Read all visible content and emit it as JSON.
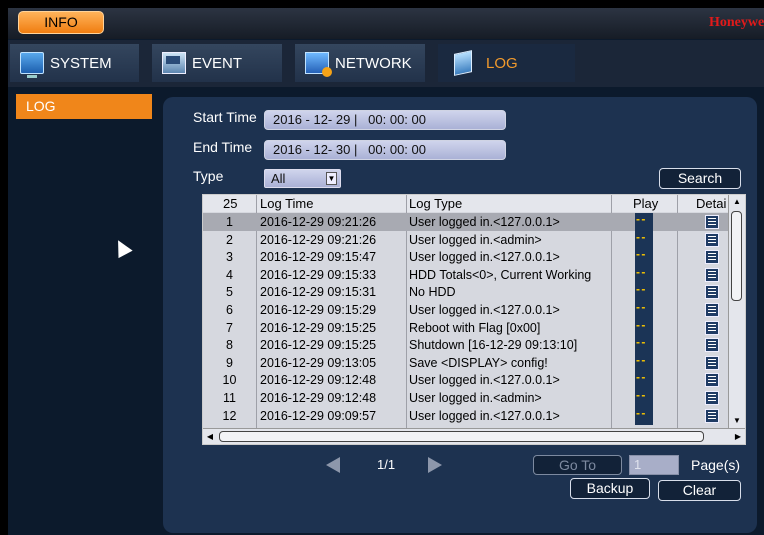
{
  "titlebar": {
    "info_label": "INFO",
    "brand": "Honeywell"
  },
  "tabs": [
    {
      "label": "SYSTEM",
      "icon": "system-icon"
    },
    {
      "label": "EVENT",
      "icon": "event-icon"
    },
    {
      "label": "NETWORK",
      "icon": "network-icon"
    },
    {
      "label": "LOG",
      "icon": "log-icon",
      "active": true
    }
  ],
  "sidebar": {
    "items": [
      {
        "label": "LOG",
        "active": true
      }
    ]
  },
  "filters": {
    "start_label": "Start Time",
    "start_value": "2016 - 12- 29 |   00: 00: 00",
    "end_label": "End Time",
    "end_value": "2016 - 12- 30 |   00: 00: 00",
    "type_label": "Type",
    "type_value": "All",
    "search_label": "Search"
  },
  "table": {
    "headers": {
      "count": "25",
      "time": "Log Time",
      "type": "Log Type",
      "play": "Play",
      "detail": "Detai"
    },
    "rows": [
      {
        "no": "1",
        "time": "2016-12-29 09:21:26",
        "type": "User logged in.<127.0.0.1>"
      },
      {
        "no": "2",
        "time": "2016-12-29 09:21:26",
        "type": "User logged in.<admin>"
      },
      {
        "no": "3",
        "time": "2016-12-29 09:15:47",
        "type": "User logged in.<127.0.0.1>"
      },
      {
        "no": "4",
        "time": "2016-12-29 09:15:33",
        "type": "HDD Totals<0>, Current Working"
      },
      {
        "no": "5",
        "time": "2016-12-29 09:15:31",
        "type": "No HDD"
      },
      {
        "no": "6",
        "time": "2016-12-29 09:15:29",
        "type": "User logged in.<127.0.0.1>"
      },
      {
        "no": "7",
        "time": "2016-12-29 09:15:25",
        "type": "Reboot with Flag [0x00]"
      },
      {
        "no": "8",
        "time": "2016-12-29 09:15:25",
        "type": "Shutdown [16-12-29 09:13:10]"
      },
      {
        "no": "9",
        "time": "2016-12-29 09:13:05",
        "type": "Save <DISPLAY> config!"
      },
      {
        "no": "10",
        "time": "2016-12-29 09:12:48",
        "type": "User logged in.<127.0.0.1>"
      },
      {
        "no": "11",
        "time": "2016-12-29 09:12:48",
        "type": "User logged in.<admin>"
      },
      {
        "no": "12",
        "time": "2016-12-29 09:09:57",
        "type": "User logged in.<127.0.0.1>"
      }
    ]
  },
  "pager": {
    "page_indicator": "1/1",
    "goto_label": "Go To",
    "page_input": "1",
    "pages_label": "Page(s)"
  },
  "actions": {
    "backup_label": "Backup",
    "clear_label": "Clear"
  }
}
